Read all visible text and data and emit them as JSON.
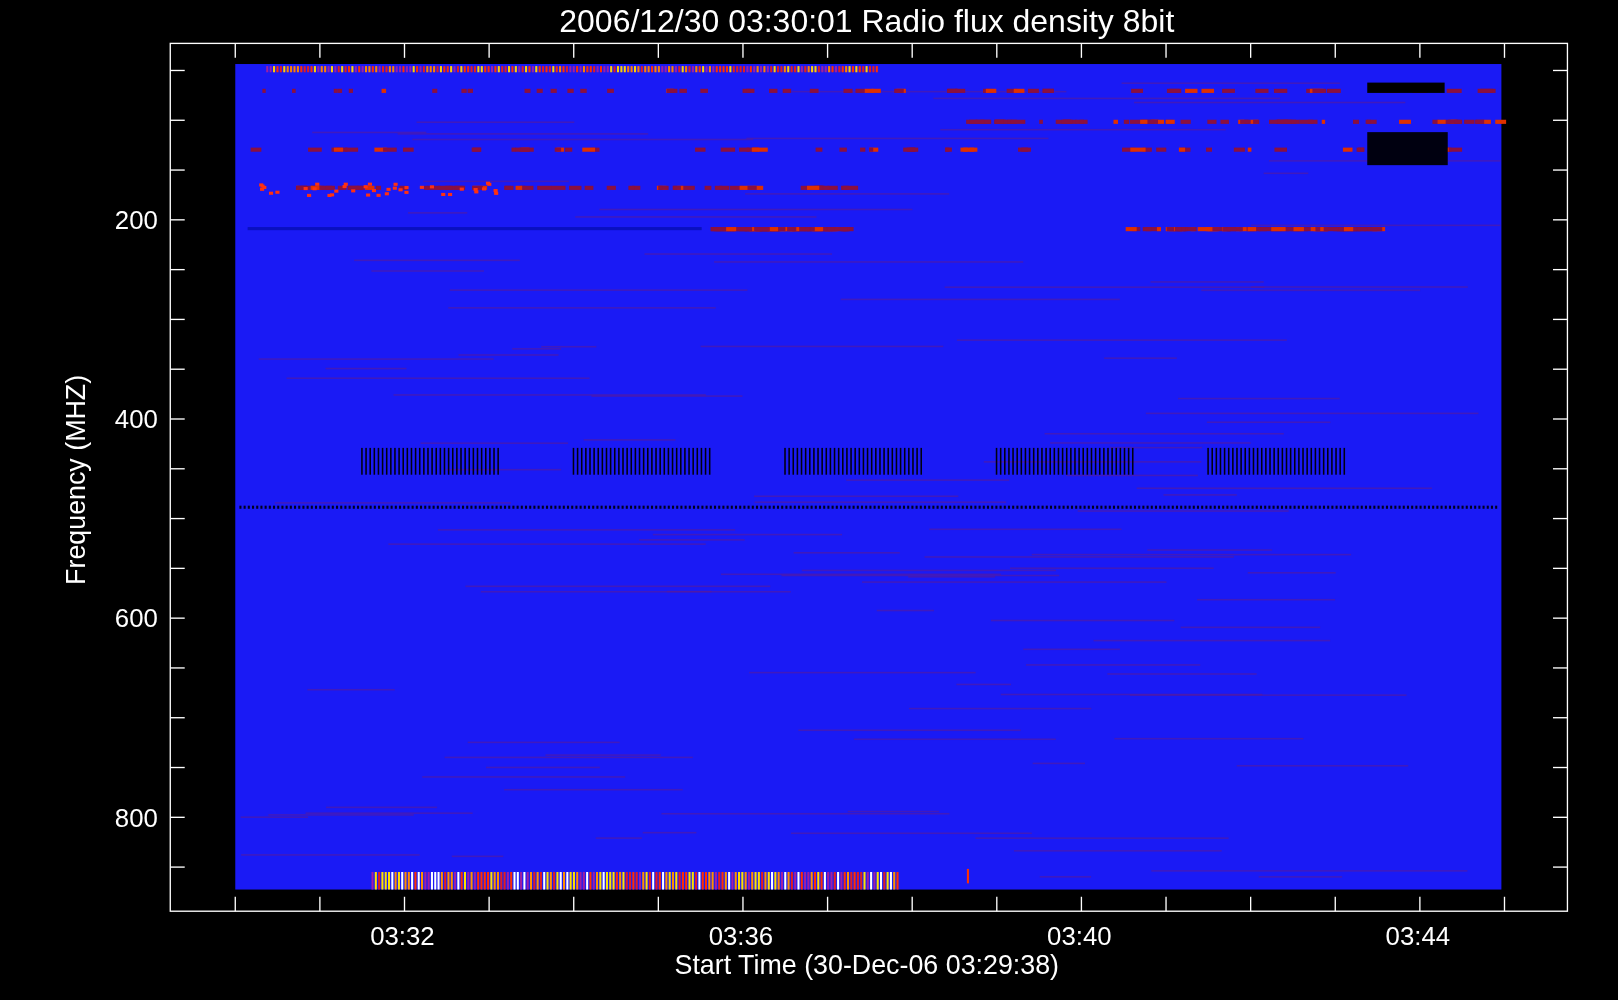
{
  "title": "2006/12/30 03:30:01 Radio flux density 8bit",
  "ylabel": "Frequency (MHZ)",
  "yticks": [
    "200",
    "400",
    "600",
    "800"
  ],
  "xticks": [
    "03:32",
    "03:36",
    "03:40",
    "03:44"
  ],
  "xlabel": "Start Time (30-Dec-06 03:29:38)"
}
